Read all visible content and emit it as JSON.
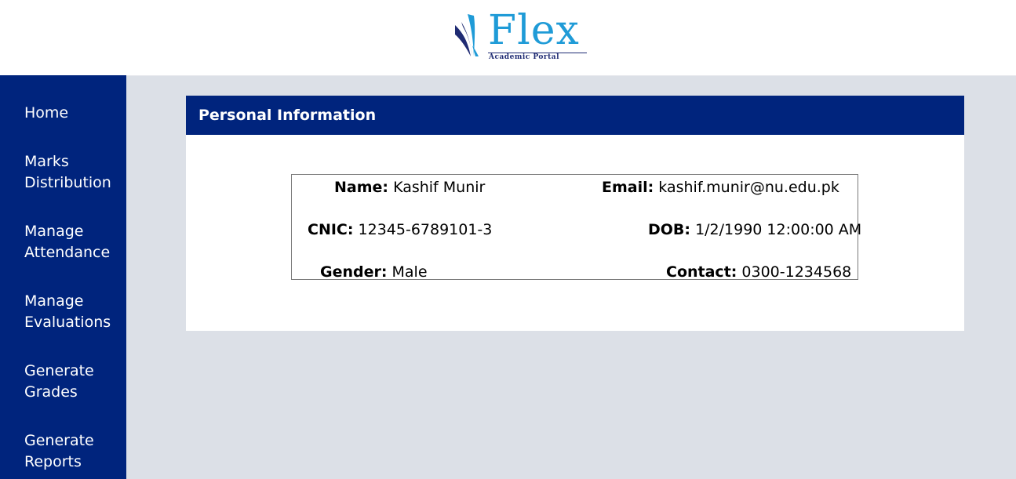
{
  "header": {
    "logo_word": "Flex",
    "logo_subtitle": "Academic Portal"
  },
  "sidebar": {
    "items": [
      {
        "line1": "Home",
        "line2": ""
      },
      {
        "line1": "Marks",
        "line2": "Distribution"
      },
      {
        "line1": "Manage",
        "line2": "Attendance"
      },
      {
        "line1": "Manage",
        "line2": "Evaluations"
      },
      {
        "line1": "Generate",
        "line2": "Grades"
      },
      {
        "line1": "Generate",
        "line2": "Reports"
      }
    ]
  },
  "panel": {
    "title": "Personal Information",
    "fields": {
      "name": {
        "label": "Name:",
        "value": "Kashif Munir"
      },
      "email": {
        "label": "Email:",
        "value": "kashif.munir@nu.edu.pk"
      },
      "cnic": {
        "label": "CNIC:",
        "value": "12345-6789101-3"
      },
      "dob": {
        "label": "DOB:",
        "value": "1/2/1990 12:00:00 AM"
      },
      "gender": {
        "label": "Gender:",
        "value": "Male"
      },
      "contact": {
        "label": "Contact:",
        "value": "0300-1234568"
      }
    }
  },
  "colors": {
    "navy": "#00247d",
    "logo_blue": "#1f9bd7",
    "page_bg": "#dce0e7"
  }
}
